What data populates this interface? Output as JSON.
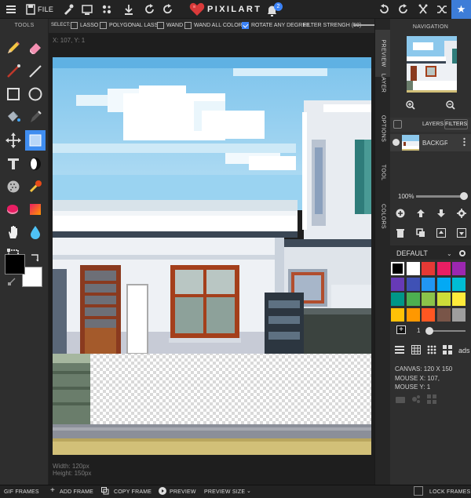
{
  "topbar": {
    "file_label": "FILE",
    "logo_text": "PIXILART",
    "notification_count": "2",
    "icons": [
      "menu-icon",
      "file-icon",
      "eyedropper-icon",
      "resize-icon",
      "settings-icon",
      "download-icon",
      "redo-icon",
      "bell-icon",
      "undo-icon",
      "redo-icon",
      "crop-icon",
      "shuffle-icon",
      "star-icon"
    ]
  },
  "tools": {
    "title": "TOOLS",
    "items": [
      "pencil",
      "eraser",
      "line",
      "pixel-line",
      "rectangle",
      "ellipse",
      "fill-bucket",
      "pen",
      "move",
      "select",
      "text",
      "shade",
      "dither",
      "stamp",
      "magic-eraser",
      "gradient",
      "hand",
      "water",
      "crop"
    ],
    "active": "select",
    "primary_color": "#000000",
    "secondary_color": "#ffffff"
  },
  "selectbar": {
    "select_label": "SELECT:",
    "options": [
      {
        "label": "LASSO",
        "checked": false
      },
      {
        "label": "POLYGONAL LASSO",
        "checked": false
      },
      {
        "label": "WAND",
        "checked": false
      },
      {
        "label": "WAND ALL COLORS",
        "checked": false
      },
      {
        "label": "ROTATE ANY DEGREE",
        "checked": true
      }
    ],
    "filter_label": "FILTER STRENGH (50)"
  },
  "canvas": {
    "mouse_readout": "X: 107, Y: 1",
    "width_label": "Width: 120px",
    "height_label": "Height: 150px"
  },
  "vertical_tabs": [
    "PREVIEW",
    "LAYER",
    "OPTIONS",
    "TOOL",
    "COLORS"
  ],
  "navigation": {
    "title": "NAVIGATION"
  },
  "layers": {
    "title": "LAYERS",
    "filters_label": "FILTERS",
    "layer_name": "BACKGROUND",
    "opacity": "100%"
  },
  "palette": {
    "name": "DEFAULT",
    "selected": "#000000",
    "colors": [
      "#000000",
      "#ffffff",
      "#e53935",
      "#e91e63",
      "#9c27b0",
      "#673ab7",
      "#3f51b5",
      "#2196f3",
      "#03a9f4",
      "#00bcd4",
      "#009688",
      "#4caf50",
      "#8bc34a",
      "#cddc39",
      "#ffeb3b",
      "#ffc107",
      "#ff9800",
      "#ff5722",
      "#795548",
      "#9e9e9e"
    ]
  },
  "brush": {
    "size": "1"
  },
  "ads_label": "ads",
  "info": {
    "canvas": "CANVAS: 120 X 150",
    "mouse_x": "MOUSE X: 107,",
    "mouse_y": "MOUSE Y: 1"
  },
  "bottombar": {
    "gif_frames": "GIF FRAMES",
    "add_frame": "ADD FRAME",
    "copy_frame": "COPY FRAME",
    "preview": "PREVIEW",
    "preview_size": "PREVIEW SIZE",
    "lock_frames": "LOCK FRAMES"
  }
}
